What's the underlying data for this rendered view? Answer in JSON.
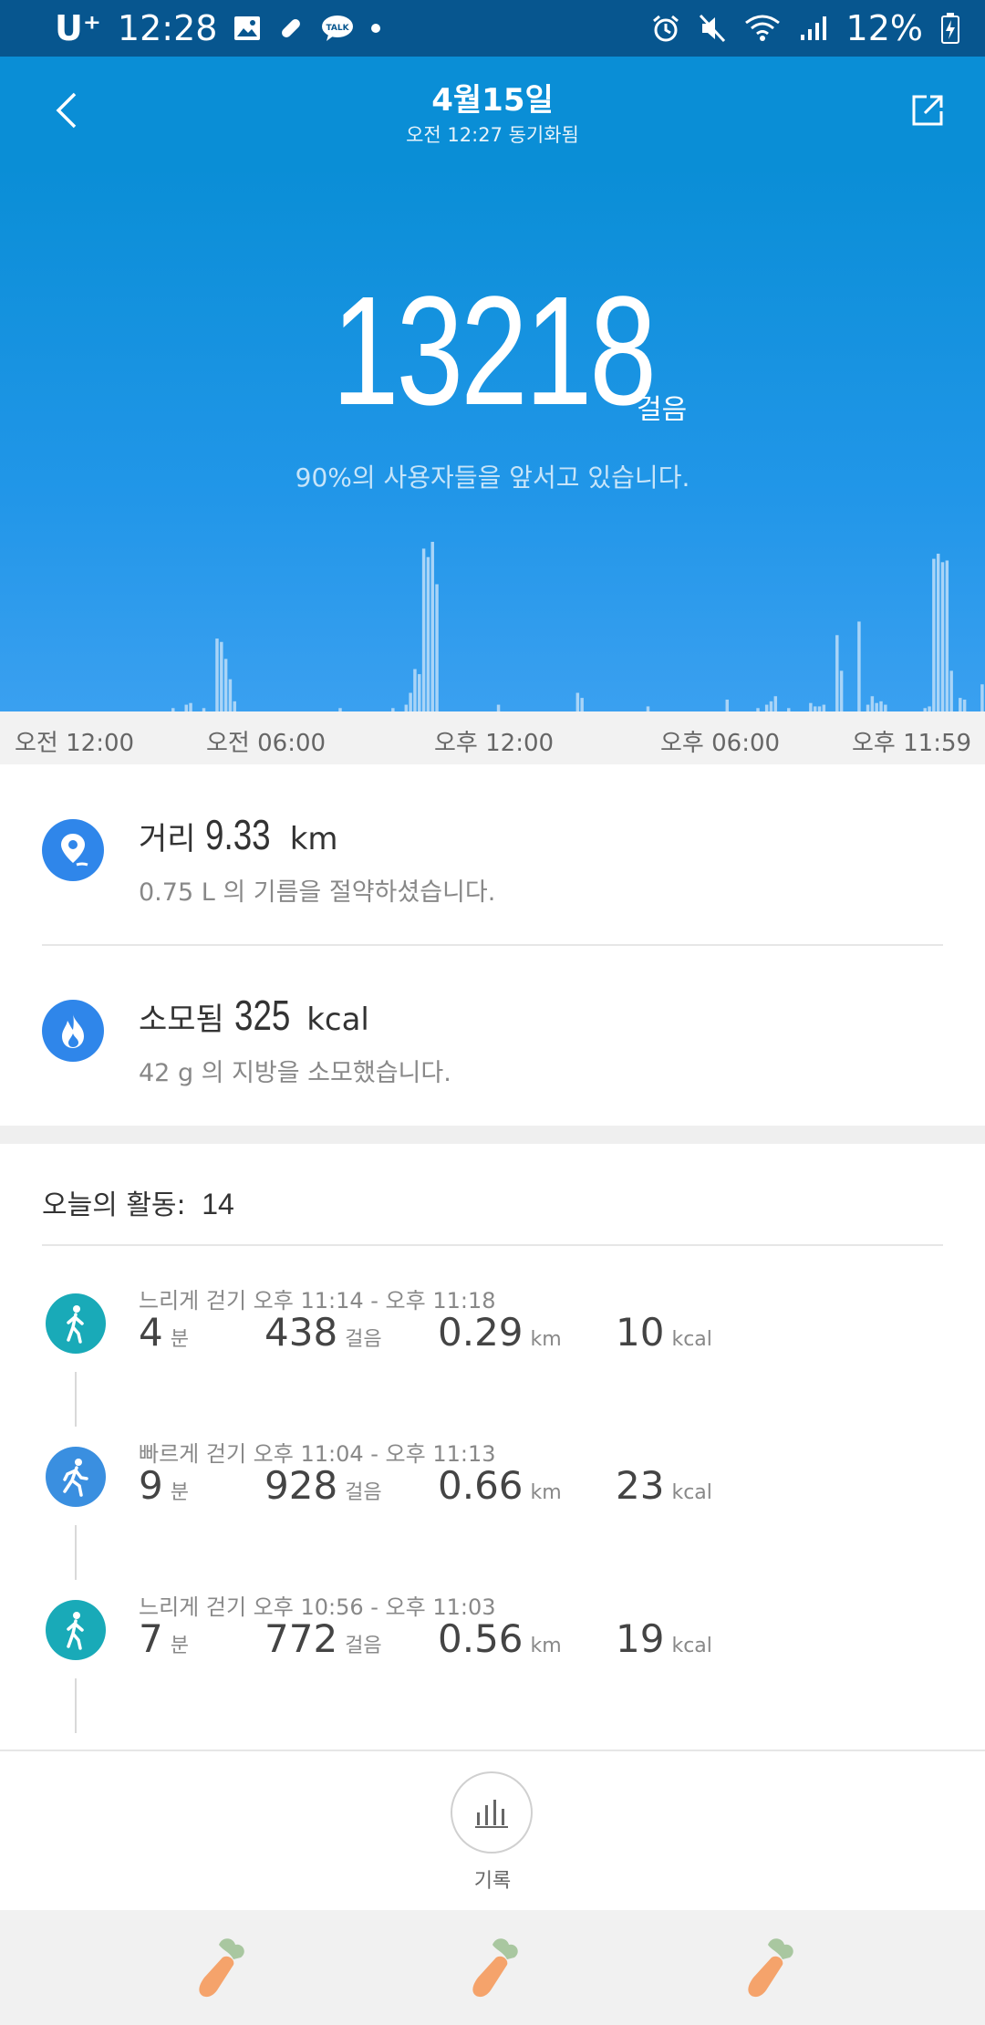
{
  "status_bar": {
    "carrier": "U⁺",
    "time": "12:28",
    "left_icons": [
      "image-icon",
      "pill-icon",
      "talk-icon",
      "dot-icon"
    ],
    "right_icons": [
      "alarm-icon",
      "mute-icon",
      "wifi-icon",
      "signal-icon",
      "battery-icon"
    ],
    "battery": "12%",
    "talk_label": "TALK"
  },
  "header": {
    "title": "4월15일",
    "subtitle": "오전 12:27 동기화됨",
    "back_icon": "chevron-left-icon",
    "share_icon": "share-icon"
  },
  "hero": {
    "steps": "13218",
    "steps_unit": "걸음",
    "rank_text": "90%의 사용자들을 앞서고 있습니다.",
    "histogram_levels": [
      0,
      0,
      0,
      0,
      0,
      0,
      0,
      0,
      0,
      0,
      0,
      0,
      0,
      0,
      0,
      0,
      0,
      0,
      0,
      0,
      0,
      0,
      0,
      0,
      0,
      0,
      0,
      0,
      0,
      0,
      0,
      0,
      0,
      0,
      0,
      0,
      0,
      0,
      0,
      0.02,
      0,
      0,
      0.04,
      0.05,
      0,
      0,
      0.02,
      0,
      0,
      0.43,
      0.41,
      0.31,
      0.19,
      0.06,
      0,
      0,
      0,
      0,
      0,
      0,
      0,
      0,
      0,
      0,
      0,
      0,
      0,
      0,
      0,
      0,
      0,
      0,
      0,
      0,
      0,
      0,
      0,
      0.02,
      0,
      0,
      0,
      0,
      0,
      0,
      0,
      0,
      0,
      0,
      0,
      0.02,
      0,
      0,
      0.04,
      0.11,
      0.25,
      0.22,
      0.96,
      0.91,
      1.0,
      0.75,
      0,
      0,
      0,
      0,
      0,
      0,
      0,
      0,
      0,
      0,
      0,
      0,
      0,
      0.04,
      0,
      0,
      0,
      0,
      0,
      0,
      0,
      0,
      0,
      0,
      0,
      0,
      0,
      0,
      0,
      0,
      0,
      0.11,
      0.08,
      0,
      0,
      0,
      0,
      0,
      0,
      0,
      0,
      0,
      0,
      0,
      0,
      0,
      0,
      0.03,
      0,
      0,
      0,
      0,
      0,
      0,
      0,
      0,
      0,
      0,
      0,
      0,
      0,
      0,
      0,
      0,
      0,
      0.07,
      0,
      0,
      0,
      0,
      0,
      0,
      0.02,
      0,
      0.04,
      0.06,
      0.09,
      0,
      0,
      0.02,
      0,
      0,
      0,
      0,
      0.05,
      0.03,
      0.03,
      0.04,
      0,
      0,
      0.45,
      0.24,
      0,
      0,
      0,
      0.53,
      0,
      0.04,
      0.09,
      0.05,
      0.06,
      0.04,
      0,
      0,
      0,
      0,
      0,
      0,
      0,
      0,
      0.02,
      0.03,
      0.9,
      0.93,
      0.88,
      0.89,
      0.24,
      0,
      0.08,
      0.07,
      0,
      0,
      0,
      0.16
    ]
  },
  "time_axis": [
    "오전 12:00",
    "오전 06:00",
    "오후 12:00",
    "오후 06:00",
    "오후 11:59"
  ],
  "summary": [
    {
      "icon": "location-pin-icon",
      "label": "거리",
      "value": "9.33",
      "unit": "km",
      "subtext": "0.75 L 의 기름을 절약하셨습니다."
    },
    {
      "icon": "flame-icon",
      "label": "소모됨",
      "value": "325",
      "unit": "kcal",
      "subtext": "42 g 의 지방을 소모했습니다."
    }
  ],
  "activities": {
    "header_label": "오늘의 활동:",
    "count": "14",
    "items": [
      {
        "icon": "walking-icon",
        "color": "#19aab8",
        "title": "느리게 걷기 오후 11:14 - 오후 11:18",
        "minutes": "4",
        "minutes_unit": "분",
        "steps": "438",
        "steps_unit": "걸음",
        "distance": "0.29",
        "distance_unit": "km",
        "kcal": "10",
        "kcal_unit": "kcal"
      },
      {
        "icon": "fast-walking-icon",
        "color": "#3a8fe0",
        "title": "빠르게 걷기 오후 11:04 - 오후 11:13",
        "minutes": "9",
        "minutes_unit": "분",
        "steps": "928",
        "steps_unit": "걸음",
        "distance": "0.66",
        "distance_unit": "km",
        "kcal": "23",
        "kcal_unit": "kcal"
      },
      {
        "icon": "walking-icon",
        "color": "#19aab8",
        "title": "느리게 걷기 오후 10:56 - 오후 11:03",
        "minutes": "7",
        "minutes_unit": "분",
        "steps": "772",
        "steps_unit": "걸음",
        "distance": "0.56",
        "distance_unit": "km",
        "kcal": "19",
        "kcal_unit": "kcal"
      }
    ]
  },
  "bottom": {
    "record_label": "기록",
    "record_icon": "bar-chart-icon",
    "nav_icons": [
      "carrot-icon",
      "carrot-icon",
      "carrot-icon"
    ]
  },
  "colors": {
    "status_bar": "#07568f",
    "header": "#0a8ed6",
    "accent_blue": "#2f86ea",
    "walk_teal": "#19aab8"
  }
}
